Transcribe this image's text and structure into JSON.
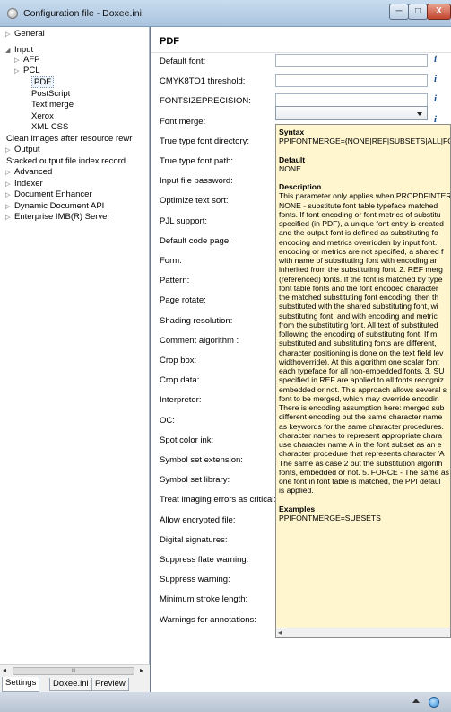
{
  "window": {
    "title": "Configuration file - Doxee.ini",
    "minimize_label": "─",
    "maximize_label": "□",
    "close_label": "X"
  },
  "tree": {
    "items": [
      {
        "label": "General",
        "arrow": "▷",
        "indent": 0,
        "selected": false
      },
      {
        "label": "Input",
        "arrow": "◢",
        "indent": 0,
        "selected": false
      },
      {
        "label": "AFP",
        "arrow": "▷",
        "indent": 1,
        "selected": false
      },
      {
        "label": "PCL",
        "arrow": "▷",
        "indent": 1,
        "selected": false
      },
      {
        "label": "PDF",
        "arrow": "",
        "indent": 2,
        "selected": true
      },
      {
        "label": "PostScript",
        "arrow": "",
        "indent": 2,
        "selected": false
      },
      {
        "label": "Text merge",
        "arrow": "",
        "indent": 2,
        "selected": false
      },
      {
        "label": "Xerox",
        "arrow": "",
        "indent": 2,
        "selected": false
      },
      {
        "label": "XML CSS",
        "arrow": "",
        "indent": 2,
        "selected": false
      },
      {
        "label": "Clean images after resource rewr",
        "arrow": "",
        "indent": 3,
        "selected": false
      },
      {
        "label": "Output",
        "arrow": "▷",
        "indent": 0,
        "selected": false
      },
      {
        "label": "Stacked output file index record",
        "arrow": "",
        "indent": 3,
        "selected": false
      },
      {
        "label": "Advanced",
        "arrow": "▷",
        "indent": 0,
        "selected": false
      },
      {
        "label": "Indexer",
        "arrow": "▷",
        "indent": 0,
        "selected": false
      },
      {
        "label": "Document Enhancer",
        "arrow": "▷",
        "indent": 0,
        "selected": false
      },
      {
        "label": "Dynamic Document API",
        "arrow": "▷",
        "indent": 0,
        "selected": false
      },
      {
        "label": "Enterprise IMB(R) Server",
        "arrow": "▷",
        "indent": 0,
        "selected": false
      }
    ],
    "scroll_left": "◂",
    "scroll_right": "▸",
    "scroll_grip": "III"
  },
  "tabs": [
    "Settings",
    "Doxee.ini",
    "Preview"
  ],
  "panel": {
    "title": "PDF",
    "info_glyph": "i",
    "properties": [
      {
        "label": "Default font:",
        "control": "input"
      },
      {
        "label": "CMYK8TO1 threshold:",
        "control": "input"
      },
      {
        "label": "FONTSIZEPRECISION:",
        "control": "input"
      },
      {
        "label": "Font merge:",
        "control": "dropdown"
      },
      {
        "label": "True type font directory:",
        "control": "none"
      },
      {
        "label": "True type font path:",
        "control": "none"
      },
      {
        "label": "Input file password:",
        "control": "none"
      },
      {
        "label": "Optimize text sort:",
        "control": "none"
      },
      {
        "label": "PJL support:",
        "control": "none"
      },
      {
        "label": "Default code page:",
        "control": "none"
      },
      {
        "label": "Form:",
        "control": "none"
      },
      {
        "label": "Pattern:",
        "control": "none"
      },
      {
        "label": "Page rotate:",
        "control": "none"
      },
      {
        "label": "Shading resolution:",
        "control": "none"
      },
      {
        "label": "Comment algorithm :",
        "control": "none"
      },
      {
        "label": "Crop box:",
        "control": "none"
      },
      {
        "label": "Crop data:",
        "control": "none"
      },
      {
        "label": "Interpreter:",
        "control": "none"
      },
      {
        "label": "OC:",
        "control": "none"
      },
      {
        "label": "Spot color ink:",
        "control": "none"
      },
      {
        "label": "Symbol set extension:",
        "control": "none"
      },
      {
        "label": "Symbol set library:",
        "control": "none"
      },
      {
        "label": "Treat imaging errors as critical:",
        "control": "none"
      },
      {
        "label": "Allow encrypted file:",
        "control": "none"
      },
      {
        "label": "Digital signatures:",
        "control": "none"
      },
      {
        "label": "Suppress flate warning:",
        "control": "none"
      },
      {
        "label": "Suppress warning:",
        "control": "none"
      },
      {
        "label": "Minimum stroke length:",
        "control": "none"
      },
      {
        "label": "Warnings for annotations:",
        "control": "none"
      }
    ]
  },
  "tooltip": {
    "syntax_heading": "Syntax",
    "syntax": "PPIFONTMERGE={NONE|REF|SUBSETS|ALL|FORC",
    "default_heading": "Default",
    "default": "NONE",
    "description_heading": "Description",
    "description_lines": [
      "This parameter only applies when PROPDFINTER",
      "NONE - substitute font table typeface matched",
      "fonts. If font encoding or font metrics of substitu",
      "specified (in PDF), a unique font entry is created",
      "and the output font is defined as substituting fo",
      "encoding and metrics overridden by input font.",
      "encoding or metrics are not specified, a shared f",
      "with name of substituting font with encoding ar",
      "inherited from the substituting font. 2. REF merg",
      "(referenced) fonts. If the font is matched by type",
      "font table fonts and the font encoded character",
      "the matched substituting font encoding, then th",
      "substituted with the shared substituting font, wi",
      "substituting font, and with encoding and metric",
      "from the substituting font. All text of substituted",
      "following the encoding of substituting font. If m",
      "substituted and substituting fonts are different,",
      "character positioning is done on the text field lev",
      "widthoverride). At this algorithm one scalar font",
      "each typeface for all non-embedded fonts. 3. SU",
      "specified in REF are applied to all fonts recogniz",
      "embedded or not. This approach allows several s",
      "font to be merged, which may override encodin",
      "There is encoding assumption here: merged sub",
      "different encoding but the same character name",
      "as keywords for the same character procedures.",
      "character names to represent appropriate chara",
      "use character name A in the font subset as an e",
      "character procedure that represents character 'A",
      "The same as case 2 but the substitution algorith",
      "fonts, embedded or not. 5. FORCE - The same as",
      "one font in font table is matched, the PPI defaul",
      "is applied."
    ],
    "examples_heading": "Examples",
    "example": "PPIFONTMERGE=SUBSETS",
    "scroll_left": "◂"
  }
}
